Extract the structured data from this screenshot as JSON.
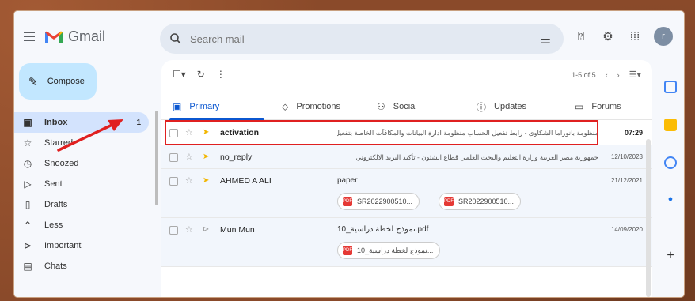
{
  "app": {
    "name": "Gmail"
  },
  "search": {
    "placeholder": "Search mail"
  },
  "topbar": {
    "avatar_letter": "r"
  },
  "compose": {
    "label": "Compose"
  },
  "sidebar": {
    "items": [
      {
        "label": "Inbox",
        "count": "1",
        "icon": "inbox-icon"
      },
      {
        "label": "Starred",
        "icon": "star-icon"
      },
      {
        "label": "Snoozed",
        "icon": "clock-icon"
      },
      {
        "label": "Sent",
        "icon": "send-icon"
      },
      {
        "label": "Drafts",
        "icon": "draft-icon"
      },
      {
        "label": "Less",
        "icon": "chevron-up-icon"
      },
      {
        "label": "Important",
        "icon": "important-icon"
      },
      {
        "label": "Chats",
        "icon": "chat-icon"
      }
    ]
  },
  "toolbar": {
    "pager_text": "1-5 of 5"
  },
  "tabs": [
    {
      "label": "Primary",
      "icon": "inbox-icon"
    },
    {
      "label": "Promotions",
      "icon": "tag-icon"
    },
    {
      "label": "Social",
      "icon": "people-icon"
    },
    {
      "label": "Updates",
      "icon": "info-icon"
    },
    {
      "label": "Forums",
      "icon": "forum-icon"
    }
  ],
  "emails": [
    {
      "sender": "activation",
      "subject": "منظومة بانوراما الشكاوى - رابط تفعيل الحساب منظومة ادارة البيانات والمكافآت الخاصة بتفعيل الحساب",
      "date": "07:29",
      "important": true,
      "unread": true,
      "highlighted": true
    },
    {
      "sender": "no_reply",
      "subject": "جمهورية مصر العربية وزارة التعليم والبحث العلمي قطاع الشئون - تأكيد البريد الالكتروني",
      "date": "12/10/2023",
      "important": true,
      "unread": false
    },
    {
      "sender": "AHMED A ALI",
      "subject": "paper",
      "date": "21/12/2021",
      "important": true,
      "unread": false,
      "attachments": [
        "SR2022900510...",
        "SR2022900510..."
      ]
    },
    {
      "sender": "Mun Mun",
      "subject": "نموذج لخطة دراسية_10.pdf",
      "date": "14/09/2020",
      "important": false,
      "unread": false,
      "attachments": [
        "نموذج لخطة دراسية_10..."
      ]
    }
  ],
  "colors": {
    "accent": "#0b57d0",
    "compose_bg": "#c2e7ff",
    "highlight": "#e02020",
    "important": "#f2b600"
  }
}
